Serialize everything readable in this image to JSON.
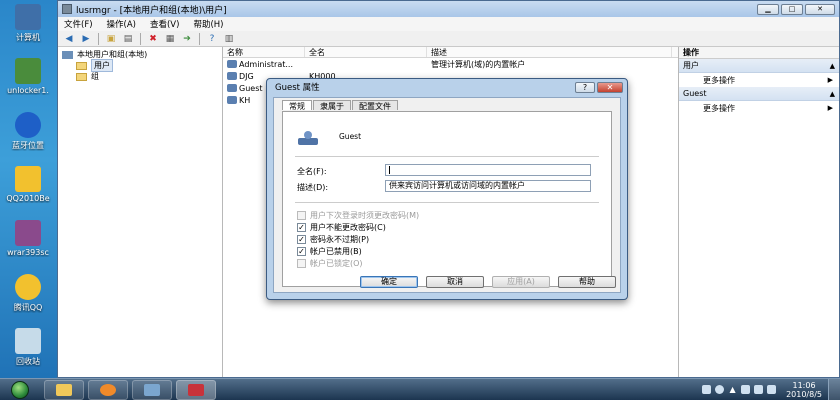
{
  "desktop": {
    "icons": [
      {
        "label": "计算机",
        "icon": "computer-icon",
        "color": "#3f6fa8"
      },
      {
        "label": "unlocker1.",
        "icon": "unlocker-icon",
        "color": "#4a8c3c"
      },
      {
        "label": "蓝牙位置",
        "icon": "bluetooth-icon",
        "color": "#1e5fc7"
      },
      {
        "label": "QQ2010Be",
        "icon": "qq-icon",
        "color": "#f2c12e"
      },
      {
        "label": "wrar393sc",
        "icon": "winrar-icon",
        "color": "#8a4a8c"
      },
      {
        "label": "腾讯QQ",
        "icon": "qq-penguin-icon",
        "color": "#f2c12e"
      },
      {
        "label": "回收站",
        "icon": "recycle-bin-icon",
        "color": "#c6dbe9"
      }
    ]
  },
  "window": {
    "title": "lusrmgr - [本地用户和组(本地)\\用户]",
    "controls": [
      "▁",
      "□",
      "✕"
    ]
  },
  "menu": [
    "文件(F)",
    "操作(A)",
    "查看(V)",
    "帮助(H)"
  ],
  "toolbar_icons": [
    "back-arrow-icon",
    "forward-arrow-icon",
    "folder-up-icon",
    "show-tree-icon",
    "delete-icon",
    "properties-icon",
    "export-icon",
    "help-icon",
    "mmc-view-icon"
  ],
  "tree": {
    "root": "本地用户和组(本地)",
    "children": [
      "用户",
      "组"
    ]
  },
  "list": {
    "headers": [
      "名称",
      "全名",
      "描述"
    ],
    "rows": [
      {
        "name": "Administrat...",
        "fullname": "",
        "desc": "管理计算机(域)的内置帐户"
      },
      {
        "name": "DJG",
        "fullname": "KH000",
        "desc": ""
      },
      {
        "name": "Guest",
        "fullname": "",
        "desc": ""
      },
      {
        "name": "KH",
        "fullname": "",
        "desc": ""
      }
    ]
  },
  "actions": {
    "title": "操作",
    "sections": [
      {
        "label": "用户",
        "item": "更多操作"
      },
      {
        "label": "Guest",
        "item": "更多操作"
      }
    ]
  },
  "dialog": {
    "title": "Guest 属性",
    "help_btn": "?",
    "close_btn": "✕",
    "tabs": [
      "常规",
      "隶属于",
      "配置文件"
    ],
    "username": "Guest",
    "fullname_label": "全名(F):",
    "fullname_value": "",
    "desc_label": "描述(D):",
    "desc_value": "供来宾访问计算机或访问域的内置帐户",
    "checkboxes": [
      {
        "label": "用户下次登录时须更改密码(M)",
        "checked": false,
        "disabled": true
      },
      {
        "label": "用户不能更改密码(C)",
        "checked": true,
        "disabled": false
      },
      {
        "label": "密码永不过期(P)",
        "checked": true,
        "disabled": false
      },
      {
        "label": "帐户已禁用(B)",
        "checked": true,
        "disabled": false
      },
      {
        "label": "帐户已锁定(O)",
        "checked": false,
        "disabled": true
      }
    ],
    "buttons": {
      "ok": "确定",
      "cancel": "取消",
      "apply": "应用(A)",
      "help": "帮助"
    }
  },
  "taskbar": {
    "items": [
      {
        "icon": "explorer-icon",
        "color": "#f0c85a"
      },
      {
        "icon": "media-player-icon",
        "color": "#f08a2a"
      },
      {
        "icon": "network-icon",
        "color": "#7ba6cf"
      },
      {
        "icon": "toolbox-icon",
        "color": "#c8323a"
      }
    ],
    "time": "11:06",
    "date": "2010/8/5"
  }
}
